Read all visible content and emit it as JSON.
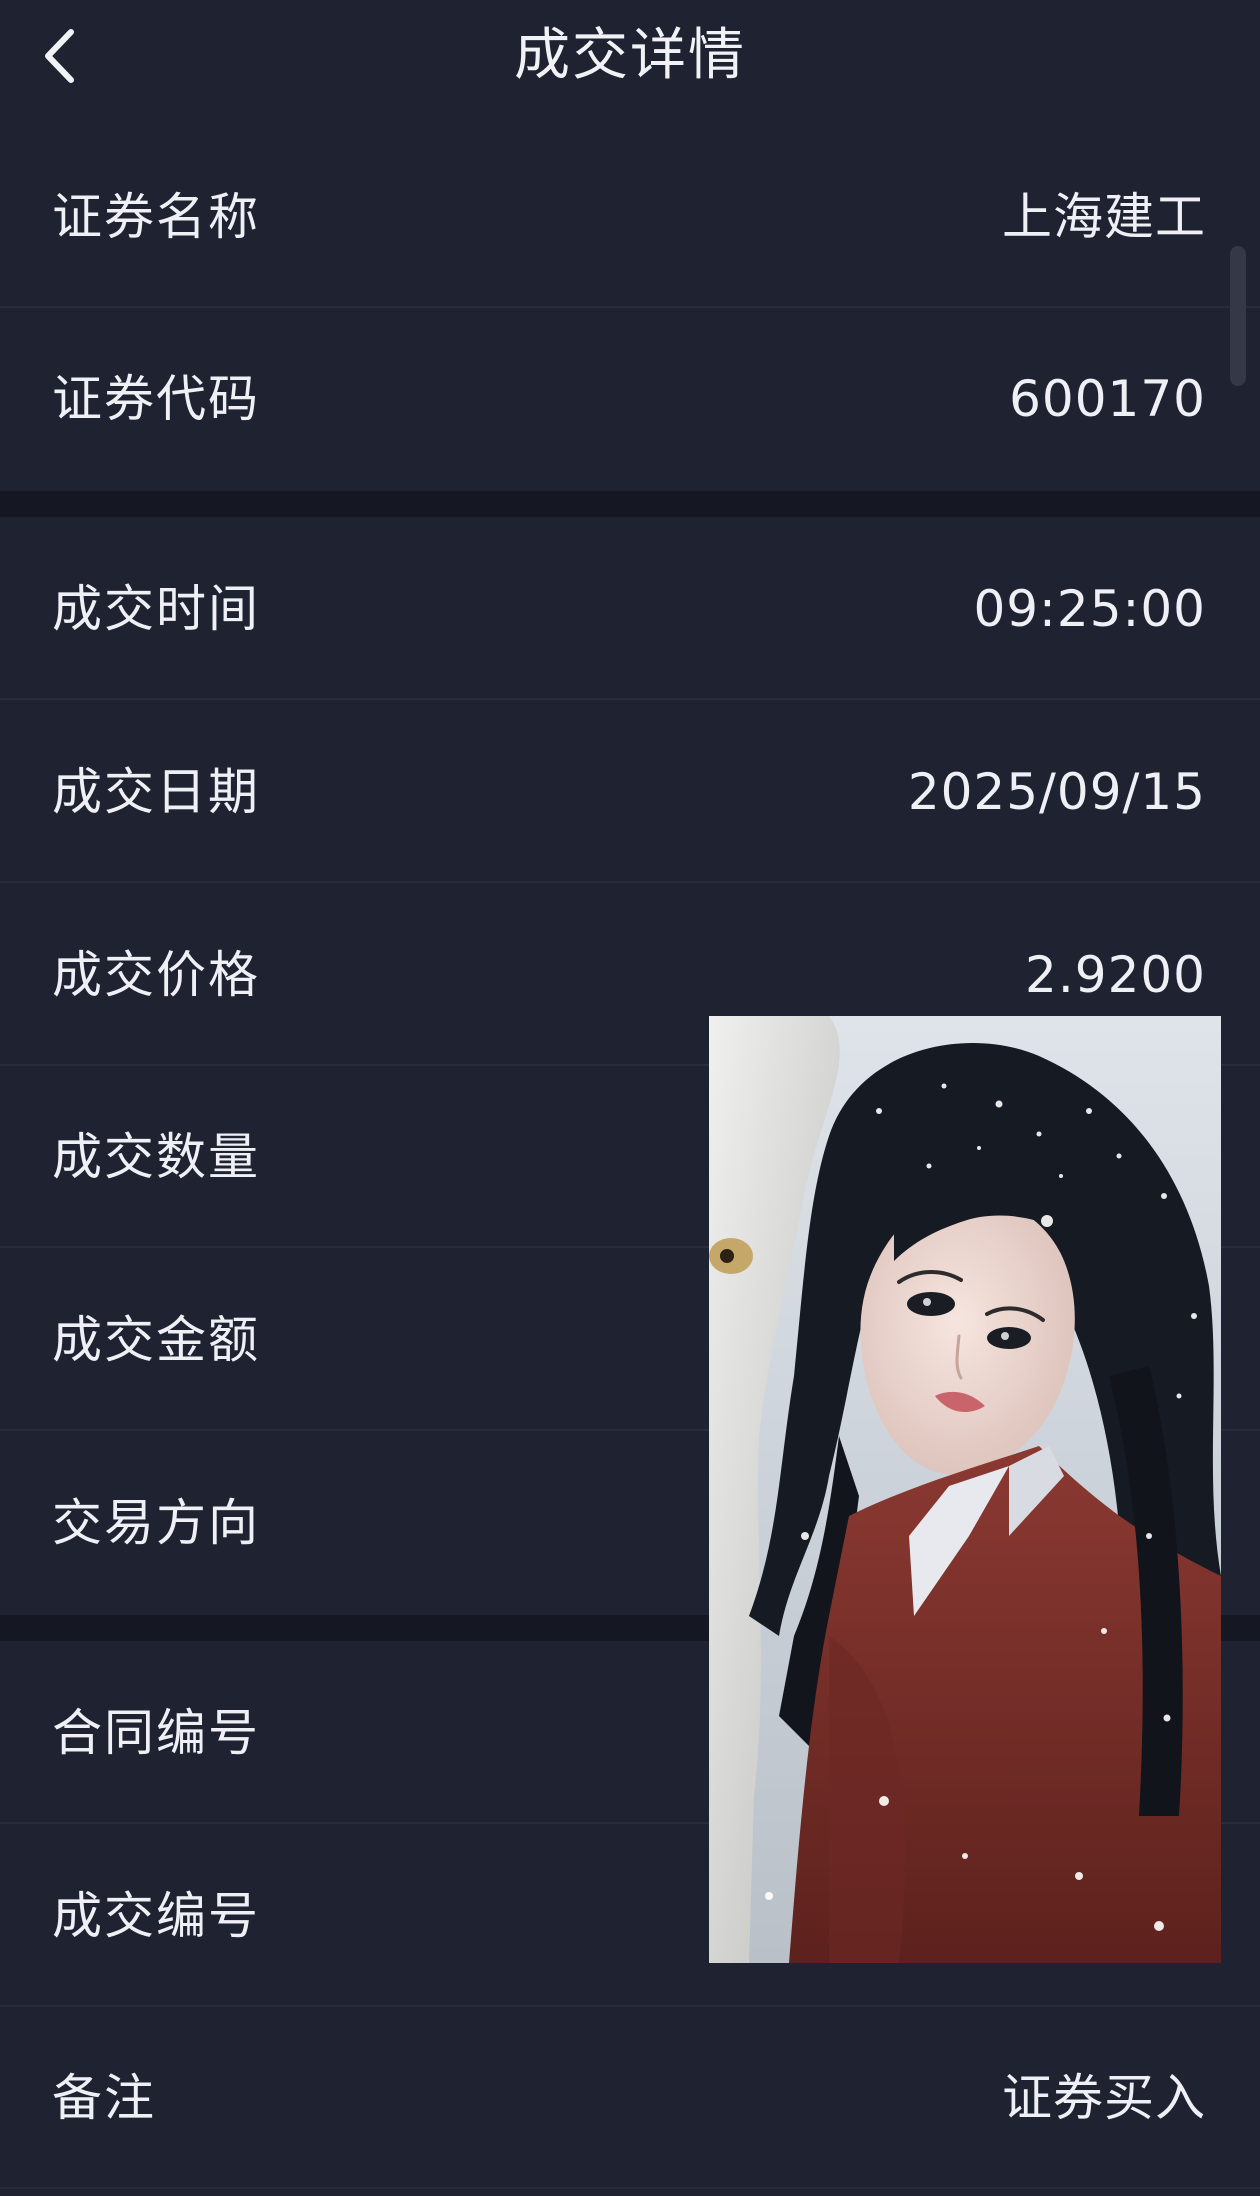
{
  "header": {
    "title": "成交详情"
  },
  "rows": [
    {
      "label": "证券名称",
      "value": "上海建工"
    },
    {
      "label": "证券代码",
      "value": "600170"
    },
    {
      "label": "成交时间",
      "value": "09:25:00"
    },
    {
      "label": "成交日期",
      "value": "2025/09/15"
    },
    {
      "label": "成交价格",
      "value": "2.9200"
    },
    {
      "label": "成交数量",
      "value": ""
    },
    {
      "label": "成交金额",
      "value": ""
    },
    {
      "label": "交易方向",
      "value": ""
    },
    {
      "label": "合同编号",
      "value": ""
    },
    {
      "label": "成交编号",
      "value": ""
    },
    {
      "label": "备注",
      "value": "证券买入"
    }
  ],
  "icons": {
    "back": "chevron-left-icon"
  },
  "colors": {
    "background": "#1f2230",
    "divider": "#292d3b",
    "section_gap": "#151722",
    "text": "#eef0f5"
  }
}
